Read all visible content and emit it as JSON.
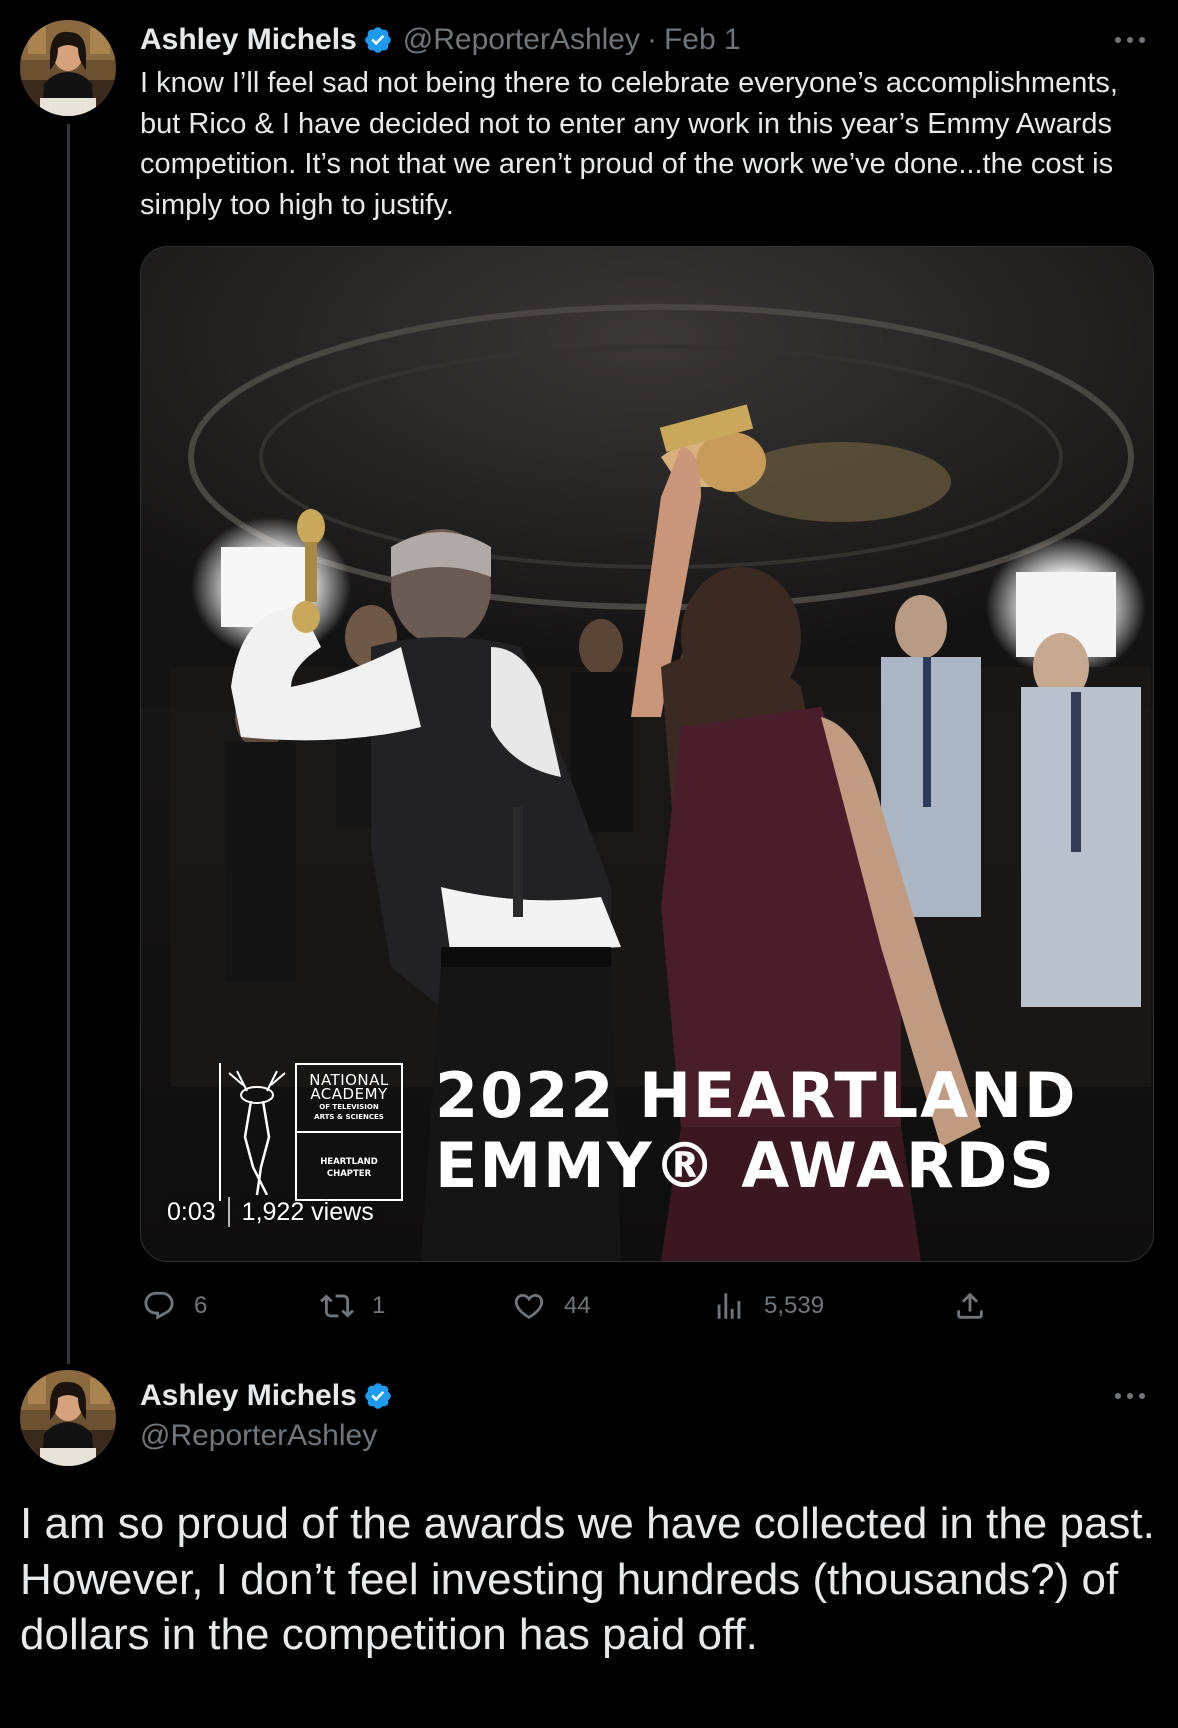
{
  "tweets": [
    {
      "author": {
        "name": "Ashley Michels",
        "handle": "@ReporterAshley",
        "verified": true
      },
      "separator": "·",
      "date": "Feb 1",
      "more_label": "More",
      "text": "I know I’ll feel sad not being there to celebrate everyone’s accomplishments, but Rico & I have decided not to enter any work in this year’s Emmy Awards competition. It’s not that we aren’t proud of the work we’ve done...the cost is simply too high to justify.",
      "media": {
        "type": "video",
        "overlay_logo": {
          "line1": "NATIONAL",
          "line2": "ACADEMY",
          "line3": "OF TELEVISION",
          "line4": "ARTS & SCIENCES",
          "line5": "HEARTLAND",
          "line6": "CHAPTER"
        },
        "overlay_title_line1": "2022 HEARTLAND",
        "overlay_title_line2": "EMMY® AWARDS",
        "timestamp": "0:03",
        "views": "1,922 views"
      },
      "actions": {
        "replies": "6",
        "retweets": "1",
        "likes": "44",
        "views": "5,539"
      }
    },
    {
      "author": {
        "name": "Ashley Michels",
        "handle": "@ReporterAshley",
        "verified": true
      },
      "more_label": "More",
      "text": "I am so proud of the awards we have collected in the past. However, I don’t feel investing hundreds (thousands?) of dollars in the competition has paid off."
    }
  ],
  "colors": {
    "background": "#000000",
    "text_primary": "#e7e9ea",
    "text_secondary": "#71767b",
    "verified_blue": "#1d9bf0",
    "thread_line": "#333639"
  }
}
